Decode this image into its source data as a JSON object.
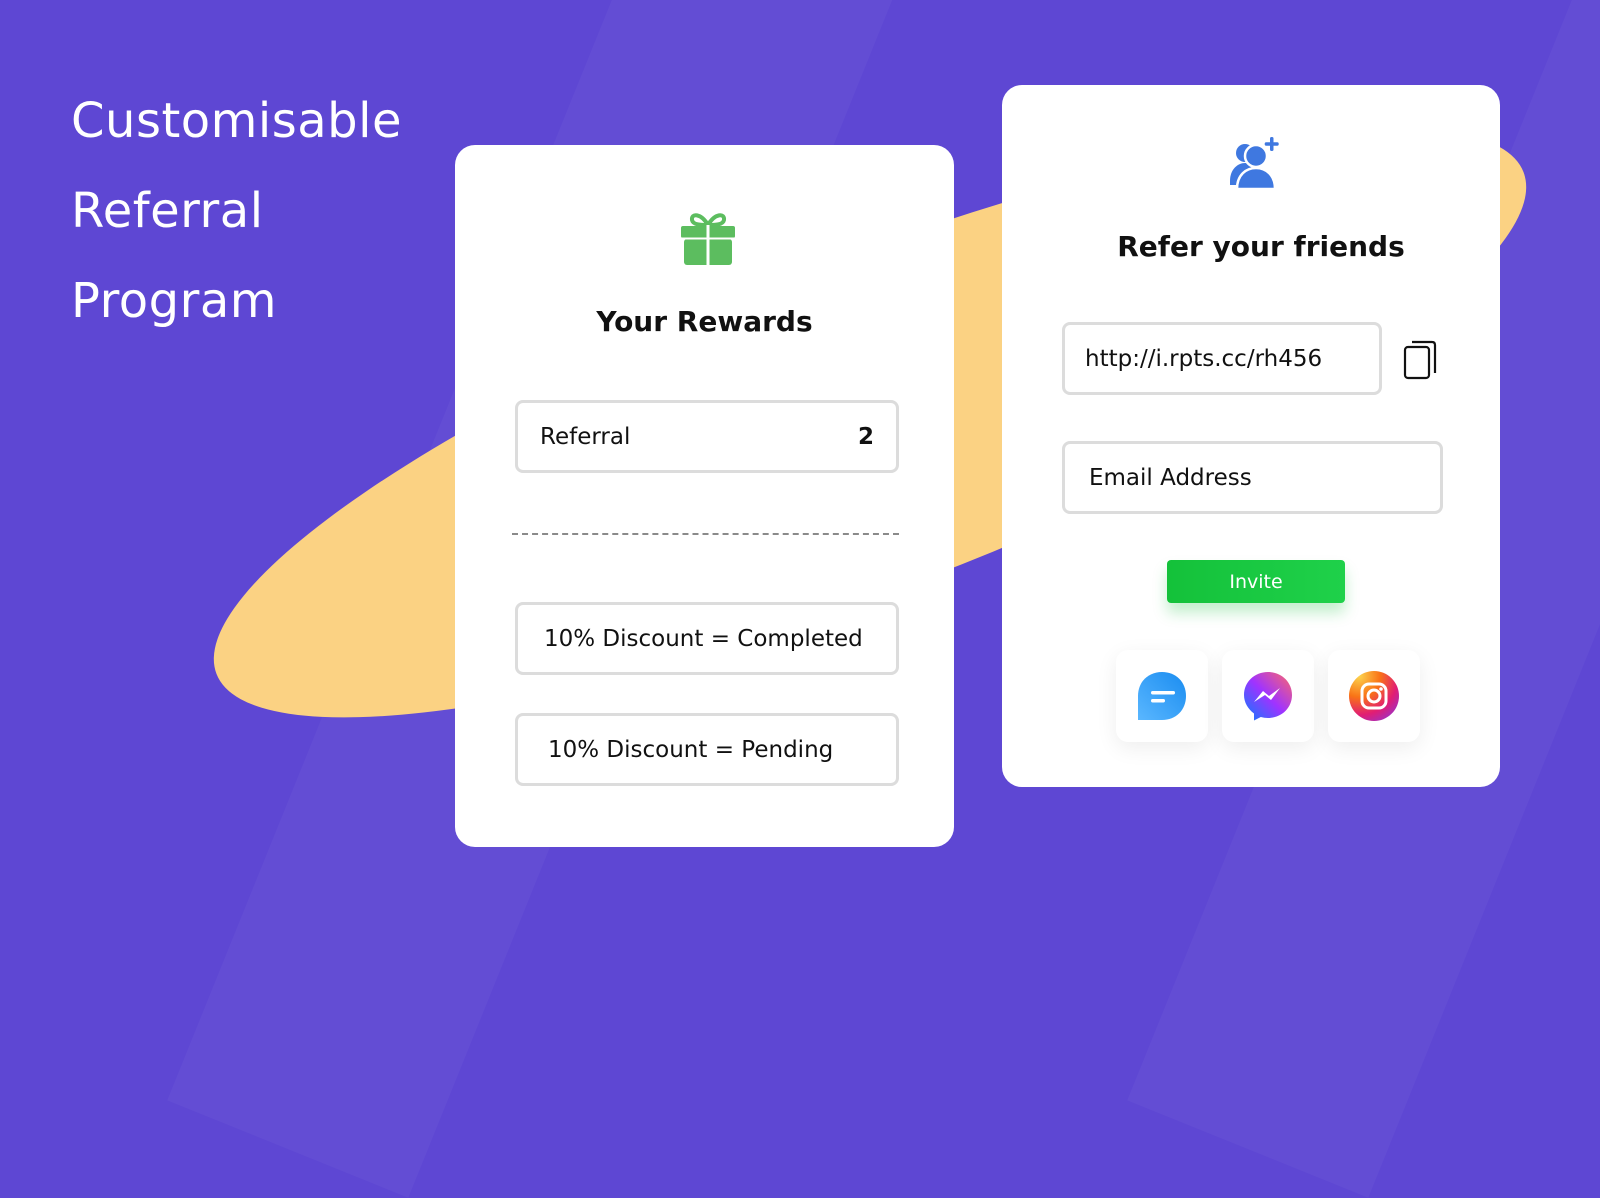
{
  "headline": {
    "lines": [
      "Customisable",
      "Referral",
      "Program"
    ]
  },
  "colors": {
    "background": "#5e47d3",
    "blob": "#fbd283",
    "gift": "#5cbd5f",
    "adduser": "#3f78e0",
    "invite_button": "#14c13a"
  },
  "rewards_card": {
    "icon": "gift-icon",
    "title": "Your Rewards",
    "referral_label": "Referral",
    "referral_count": "2",
    "discounts": [
      {
        "text": "10% Discount = Completed"
      },
      {
        "text": "10% Discount = Pending"
      }
    ]
  },
  "refer_card": {
    "icon": "add-user-icon",
    "title": "Refer your friends",
    "referral_link": "http://i.rpts.cc/rh456",
    "copy_icon": "copy-icon",
    "email_placeholder": "Email Address",
    "invite_label": "Invite",
    "share_options": [
      {
        "name": "sms",
        "icon": "message-icon"
      },
      {
        "name": "messenger",
        "icon": "messenger-icon"
      },
      {
        "name": "instagram",
        "icon": "instagram-icon"
      }
    ]
  }
}
